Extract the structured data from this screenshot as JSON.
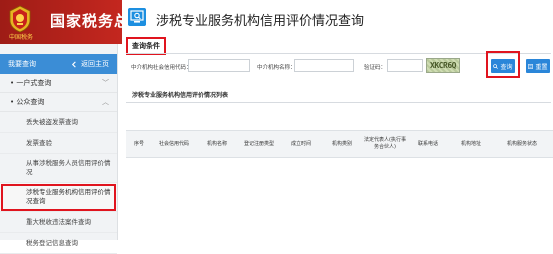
{
  "header": {
    "site_name": "国家税务总",
    "emblem_caption": "中国税务"
  },
  "sidebar": {
    "head_title": "我要查询",
    "back_label": "返回主页",
    "groups": [
      {
        "label": "一户式查询",
        "chevron": "﹀"
      },
      {
        "label": "公众查询",
        "chevron": "︿"
      }
    ],
    "items": [
      {
        "label": "丢失被盗发票查询"
      },
      {
        "label": "发票查验"
      },
      {
        "label": "从事涉税服务人员信用评价情况"
      },
      {
        "label": "涉税专业服务机构信用评价情况查询"
      },
      {
        "label": "重大税收违法案件查询"
      },
      {
        "label": "税务登记信息查询"
      }
    ]
  },
  "main": {
    "title": "涉税专业服务机构信用评价情况查询",
    "section_title": "查询条件",
    "fields": {
      "credit_code_label": "中介机构社会信用代码：",
      "credit_code_value": "",
      "org_name_label": "中介机构名称：",
      "org_name_value": "",
      "captcha_label": "验证码：",
      "captcha_value": "",
      "captcha_text": "XKCR6Q"
    },
    "buttons": {
      "query_label": "查询",
      "reset_label": "重置"
    },
    "list_title": "涉税专业服务机构信用评价情况列表",
    "table_headers": [
      "序号",
      "社会信用代码",
      "机构名称",
      "登记注册类型",
      "成立时间",
      "机构类别",
      "法定代表人(执行事务合伙人)",
      "联系电话",
      "机构地址",
      "机构服务状态"
    ]
  },
  "colors": {
    "banner": "#b8221b",
    "accent_blue": "#2a86d9",
    "highlight_red": "#e0141e"
  }
}
